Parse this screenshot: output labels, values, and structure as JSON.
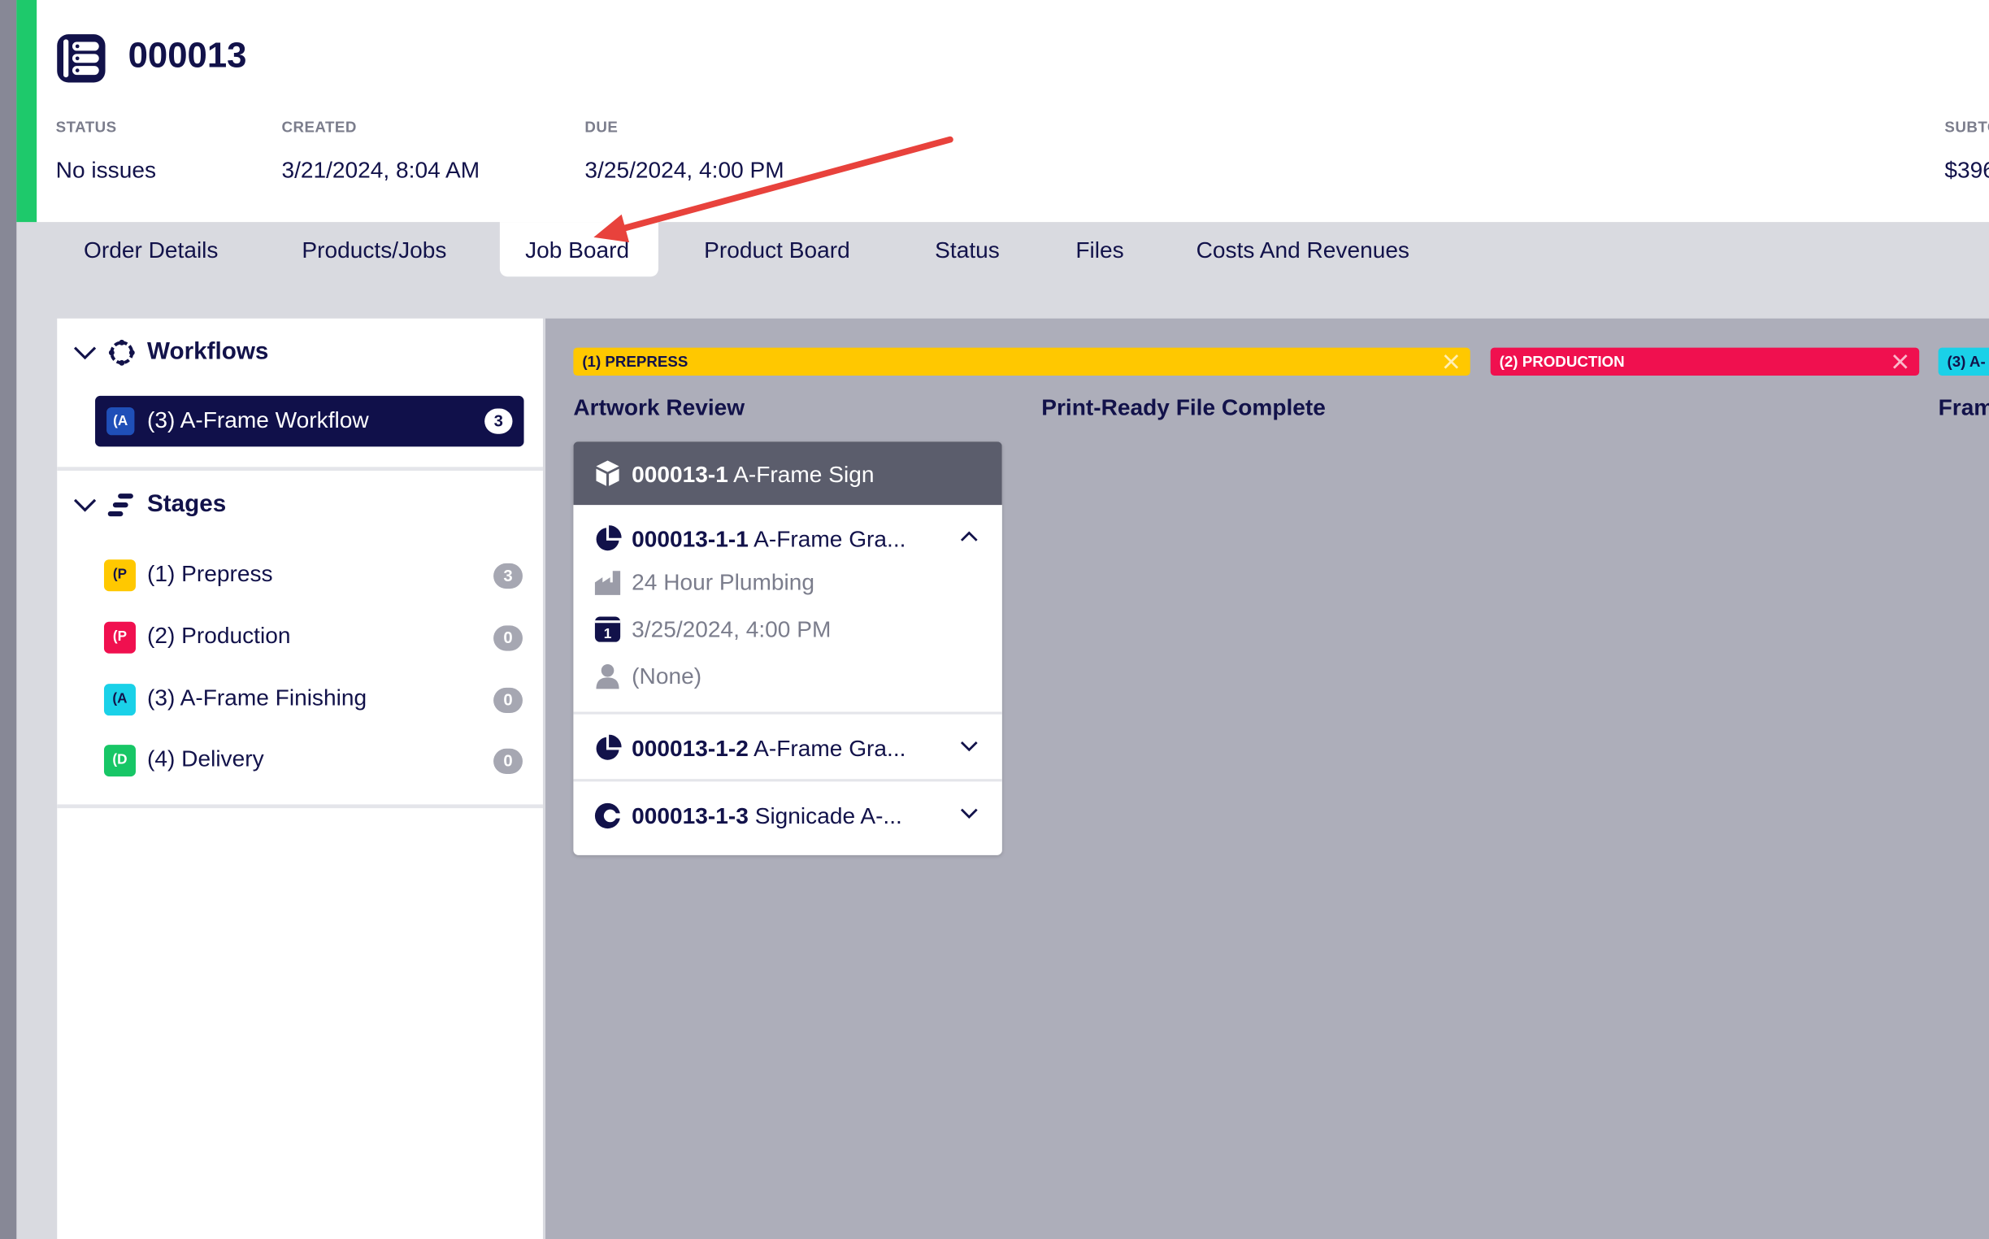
{
  "order": {
    "number": "000013",
    "status_label": "STATUS",
    "status_value": "No issues",
    "created_label": "CREATED",
    "created_value": "3/21/2024, 8:04 AM",
    "due_label": "DUE",
    "due_value": "3/25/2024, 4:00 PM",
    "subtotal_label": "SUBTO",
    "subtotal_value": "$396"
  },
  "tabs": [
    {
      "label": "Order Details"
    },
    {
      "label": "Products/Jobs"
    },
    {
      "label": "Job Board",
      "active": true
    },
    {
      "label": "Product Board"
    },
    {
      "label": "Status"
    },
    {
      "label": "Files"
    },
    {
      "label": "Costs And Revenues"
    }
  ],
  "sidebar": {
    "workflows_title": "Workflows",
    "workflow": {
      "badge": "(A",
      "label": "(3) A-Frame Workflow",
      "count": "3"
    },
    "stages_title": "Stages",
    "stages": [
      {
        "badge": "(P",
        "label": "(1) Prepress",
        "count": "3",
        "color": "#ffc800"
      },
      {
        "badge": "(P",
        "label": "(2) Production",
        "count": "0",
        "color": "#f0104f"
      },
      {
        "badge": "(A",
        "label": "(3) A-Frame Finishing",
        "count": "0",
        "color": "#1ad1e8"
      },
      {
        "badge": "(D",
        "label": "(4) Delivery",
        "count": "0",
        "color": "#17c666"
      }
    ]
  },
  "board": {
    "stage_bars": [
      {
        "label": "(1) PREPRESS",
        "color": "#ffc800"
      },
      {
        "label": "(2) PRODUCTION",
        "color": "#f0104f"
      },
      {
        "label": "(3) A-",
        "color": "#1ad1e8"
      }
    ],
    "columns": [
      {
        "title": "Artwork Review"
      },
      {
        "title": "Print-Ready File Complete"
      },
      {
        "title": "Fram"
      }
    ],
    "card": {
      "product_id": "000013-1",
      "product_name": "A-Frame Sign",
      "jobs": [
        {
          "id": "000013-1-1",
          "name": "A-Frame Gra...",
          "expanded": true,
          "customer": "24 Hour Plumbing",
          "due": "3/25/2024, 4:00 PM",
          "assignee": "(None)"
        },
        {
          "id": "000013-1-2",
          "name": "A-Frame Gra...",
          "expanded": false
        },
        {
          "id": "000013-1-3",
          "name": "Signicade A-...",
          "expanded": false
        }
      ]
    }
  },
  "annotation": {
    "color": "#e8423c"
  }
}
